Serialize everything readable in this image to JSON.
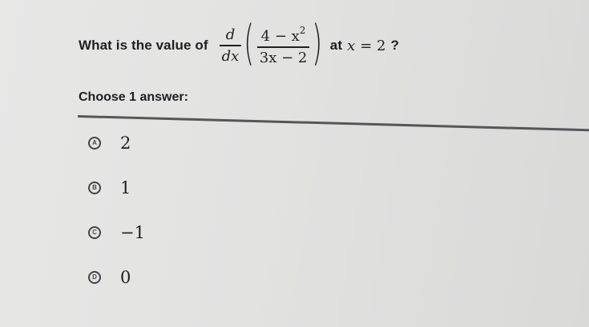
{
  "question": {
    "prefix": "What is the value of",
    "derivative_top": "d",
    "derivative_bottom": "dx",
    "fraction_numerator_left": "4 − x",
    "fraction_numerator_exponent": "2",
    "fraction_denominator": "3x − 2",
    "connector": "at",
    "condition_var": "x",
    "condition_eq": "= 2",
    "suffix": "?"
  },
  "choose_label": "Choose 1 answer:",
  "options": [
    {
      "letter": "A",
      "value": "2"
    },
    {
      "letter": "B",
      "value": "1"
    },
    {
      "letter": "C",
      "value": "−1"
    },
    {
      "letter": "D",
      "value": "0"
    }
  ],
  "colors": {
    "text": "#1f1f22",
    "circle_border": "#444447",
    "divider": "#565658",
    "background": "#e2e2e1"
  }
}
